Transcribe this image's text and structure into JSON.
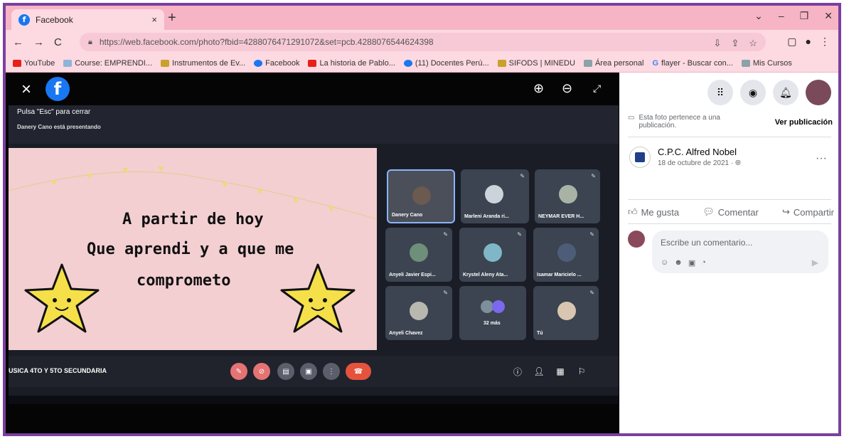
{
  "browser": {
    "tab_title": "Facebook",
    "tab_close": "×",
    "new_tab": "+",
    "window_controls": [
      "⌄",
      "–",
      "❐",
      "✕"
    ],
    "nav_back": "←",
    "nav_forward": "→",
    "nav_reload": "C",
    "url": "https://web.facebook.com/photo?fbid=4288076471291072&set=pcb.4288076544624398",
    "bookmarks": [
      {
        "label": "YouTube",
        "color": "#e62117"
      },
      {
        "label": "Course: EMPRENDI...",
        "color": "#8fb4d9"
      },
      {
        "label": "Instrumentos de Ev...",
        "color": "#c9a12b"
      },
      {
        "label": "Facebook",
        "color": "#1877f2"
      },
      {
        "label": "La historia de Pablo...",
        "color": "#e62117"
      },
      {
        "label": "(11) Docentes Perú...",
        "color": "#1877f2"
      },
      {
        "label": "SIFODS | MINEDU",
        "color": "#c9a12b"
      },
      {
        "label": "Área personal",
        "color": "#8aa2a8"
      },
      {
        "label": "flayer - Buscar con...",
        "color": "#4285f4"
      },
      {
        "label": "Mis Cursos",
        "color": "#8aa2a8"
      }
    ]
  },
  "viewer": {
    "close": "×",
    "zoom_in": "⊕",
    "zoom_out": "⊖",
    "fullscreen": "⤢",
    "photo": {
      "esc_hint": "Pulsa \"Esc\" para cerrar",
      "presenting": "Danery Cano está presentando",
      "slide_lines": [
        "A partir de hoy",
        "Que aprendi y a que me",
        "comprometo"
      ],
      "participants": [
        "Danery Cano",
        "Marleni Aranda ri...",
        "NEYMAR EVER H...",
        "Anyeli Javier Espi...",
        "Krystel Aleny Ata...",
        "Isamar Maricielo ...",
        "Anyeli Chavez",
        "32 más",
        "Tú"
      ],
      "meet_title": "USICA 4TO Y 5TO SECUNDARIA"
    }
  },
  "side": {
    "post_note": "Esta foto pertenece a una publicación.",
    "view_post": "Ver publicación",
    "author": "C.P.C. Alfred Nobel",
    "date": "18 de octubre de 2021 · ",
    "more": "···",
    "like": "Me gusta",
    "comment": "Comentar",
    "share": "Compartir",
    "comment_placeholder": "Escribe un comentario...",
    "colors": {
      "facebook_blue": "#1877f2",
      "frame": "#7b3fa0",
      "chrome_pink": "#f6b4c4"
    }
  }
}
